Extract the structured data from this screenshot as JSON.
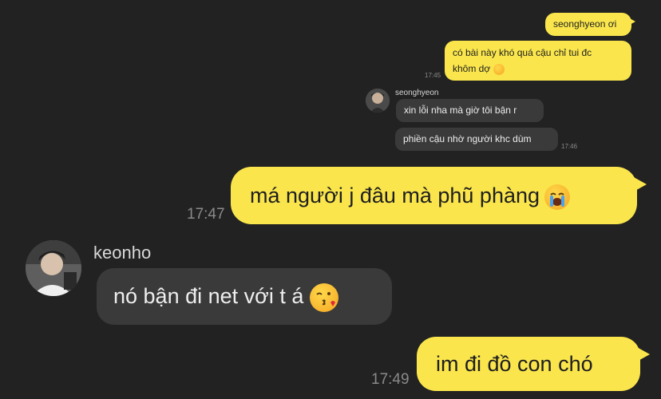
{
  "chat": {
    "messages_small": {
      "m1": {
        "text": "seonghyeon ơi"
      },
      "m2": {
        "line1": "có bài này khó quá cậu chỉ tui đc",
        "line2": "khôm dợ",
        "time": "17:45"
      },
      "m3": {
        "sender": "seonghyeon",
        "text": "xin lỗi nha mà giờ tôi bận r"
      },
      "m4": {
        "text": "phiền cậu nhờ người khc dùm",
        "time": "17:46"
      }
    },
    "messages_large": {
      "m5": {
        "text": "má người j đâu mà phũ phàng",
        "time": "17:47",
        "emoji": "crying-face"
      },
      "m6": {
        "sender": "keonho",
        "text": "nó bận đi net với t á",
        "emoji": "kissing-face"
      },
      "m7": {
        "text": "im đi đồ con chó",
        "time": "17:49"
      }
    }
  },
  "colors": {
    "background": "#222222",
    "outgoing_bubble": "#fae64c",
    "incoming_bubble": "#3a3a3a",
    "timestamp": "#8a8a8a"
  }
}
